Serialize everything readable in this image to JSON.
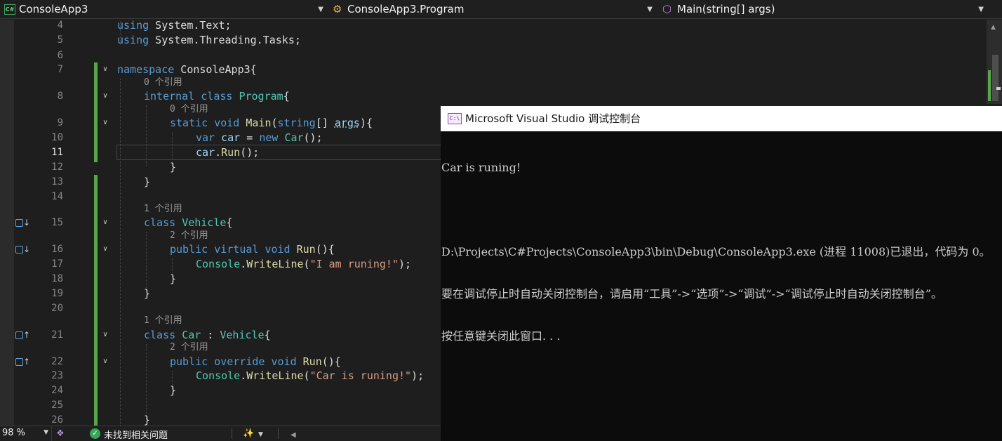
{
  "navbar": {
    "project_dropdown": {
      "label": "ConsoleApp3",
      "icon": "csharp-project-icon"
    },
    "class_dropdown": {
      "label": "ConsoleApp3.Program",
      "icon": "class-icon"
    },
    "member_dropdown": {
      "label": "Main(string[] args)",
      "icon": "method-icon"
    }
  },
  "editor": {
    "current_line": 11,
    "lines": [
      {
        "num": "4",
        "code": "using System.Text;"
      },
      {
        "num": "5",
        "code": "using System.Threading.Tasks;"
      },
      {
        "num": "6",
        "code": ""
      },
      {
        "num": "7",
        "code": "namespace ConsoleApp3{"
      },
      {
        "num": "8",
        "code": "internal class Program{",
        "lens": "0 个引用"
      },
      {
        "num": "9",
        "code": "static void Main(string[] args){",
        "lens": "0 个引用"
      },
      {
        "num": "10",
        "code": "var car = new Car();"
      },
      {
        "num": "11",
        "code": "car.Run();"
      },
      {
        "num": "12",
        "code": "}"
      },
      {
        "num": "13",
        "code": "}"
      },
      {
        "num": "14",
        "code": ""
      },
      {
        "num": "15",
        "code": "class Vehicle{",
        "lens": "1 个引用",
        "glyph": "overridden-by-icon"
      },
      {
        "num": "16",
        "code": "public virtual void Run(){",
        "lens": "2 个引用",
        "glyph": "overridden-by-icon"
      },
      {
        "num": "17",
        "code": "Console.WriteLine(\"I am runing!\");"
      },
      {
        "num": "18",
        "code": "}"
      },
      {
        "num": "19",
        "code": "}"
      },
      {
        "num": "20",
        "code": ""
      },
      {
        "num": "21",
        "code": "class Car : Vehicle{",
        "lens": "1 个引用",
        "glyph": "overrides-icon"
      },
      {
        "num": "22",
        "code": "public override void Run(){",
        "lens": "2 个引用",
        "glyph": "overrides-icon"
      },
      {
        "num": "23",
        "code": "Console.WriteLine(\"Car is runing!\");"
      },
      {
        "num": "24",
        "code": "}"
      },
      {
        "num": "25",
        "code": ""
      },
      {
        "num": "26",
        "code": "}"
      }
    ]
  },
  "statusbar": {
    "zoom": "98 %",
    "issues": "未找到相关问题",
    "issues_icon": "check-circle-icon"
  },
  "console": {
    "title": "Microsoft Visual Studio 调试控制台",
    "icon": "console-app-icon",
    "lines": [
      "Car is runing!",
      "",
      "D:\\Projects\\C#Projects\\ConsoleApp3\\bin\\Debug\\ConsoleApp3.exe (进程 11008)已退出，代码为 0。",
      "要在调试停止时自动关闭控制台，请启用“工具”->“选项”->“调试”->“调试停止时自动关闭控制台”。",
      "按任意键关闭此窗口. . ."
    ]
  },
  "colors": {
    "editor_bg": "#1e1e1e",
    "keyword": "#569cd6",
    "type": "#4ec9b0",
    "method": "#dcdcaa",
    "string": "#d69d85",
    "variable": "#9cdcfe",
    "change_bar": "#57a64a",
    "console_bg": "#0c0c0c"
  }
}
